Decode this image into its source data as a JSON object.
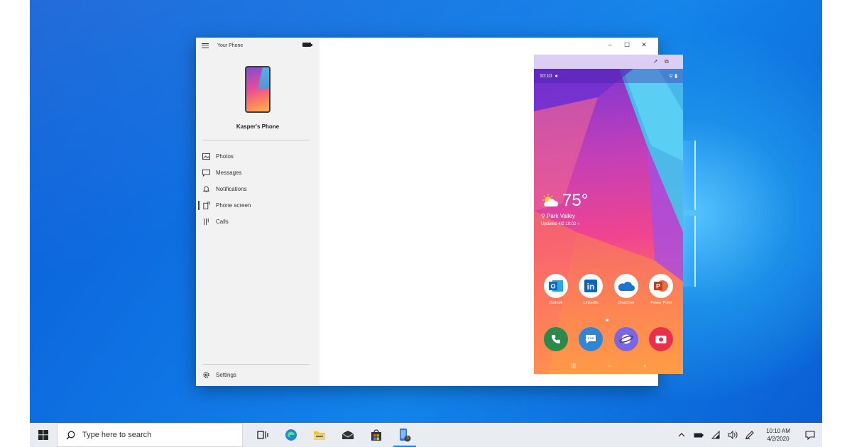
{
  "app": {
    "title": "Your Phone",
    "device_name": "Kasper's Phone",
    "nav": [
      {
        "label": "Photos",
        "icon": "photos-icon"
      },
      {
        "label": "Messages",
        "icon": "messages-icon"
      },
      {
        "label": "Notifications",
        "icon": "notifications-icon"
      },
      {
        "label": "Phone screen",
        "icon": "phone-screen-icon",
        "active": true
      },
      {
        "label": "Calls",
        "icon": "calls-icon"
      }
    ],
    "settings_label": "Settings",
    "window_controls": {
      "minimize": "–",
      "maximize": "☐",
      "close": "✕"
    }
  },
  "phone": {
    "status_time": "10:10",
    "status_right": "ᯤ ▮",
    "weather": {
      "temp": "75°",
      "location": "Park Valley",
      "updated": "Updated 4/2 10:02 ○"
    },
    "apps": [
      {
        "name": "Outlook",
        "color": "#0f6cbd",
        "glyph": "O"
      },
      {
        "name": "LinkedIn",
        "color": "#0a66c2",
        "glyph": "in"
      },
      {
        "name": "OneDrive",
        "color": "#1b73d0",
        "glyph": "☁"
      },
      {
        "name": "Power Point",
        "color": "#d24726",
        "glyph": "P"
      }
    ],
    "dock": [
      {
        "name": "phone",
        "color": "#2a8a4a",
        "glyph": "✆"
      },
      {
        "name": "messages",
        "color": "#2f86d6",
        "glyph": "⋯"
      },
      {
        "name": "internet",
        "color": "#6b5bd9",
        "glyph": "◍"
      },
      {
        "name": "camera",
        "color": "#e8304a",
        "glyph": "◉"
      }
    ],
    "navbar": {
      "recents": "|||",
      "home": "○",
      "back": "‹"
    }
  },
  "taskbar": {
    "search_placeholder": "Type here to search",
    "clock_time": "10:10 AM",
    "clock_date": "4/2/2020",
    "phone_badge": "1"
  }
}
